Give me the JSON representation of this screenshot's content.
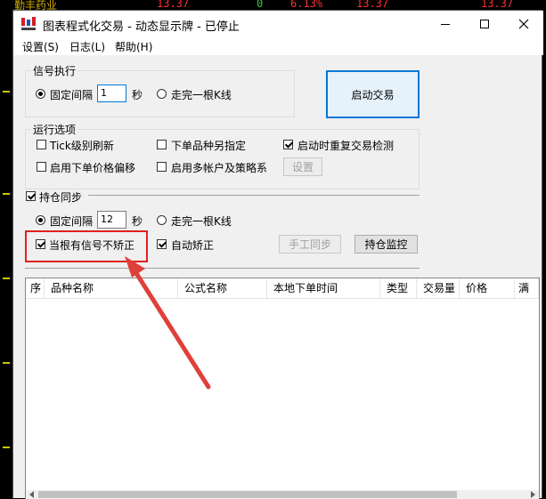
{
  "background": {
    "strip_texts": [
      "勤丰药业",
      "13.37",
      "0",
      "6.13%",
      "13.37",
      "13.37"
    ]
  },
  "window": {
    "title": "图表程式化交易 - 动态显示牌 - 已停止",
    "icon": "app-logo-icon",
    "controls": [
      "minimize-icon",
      "maximize-icon",
      "close-icon"
    ]
  },
  "menu": [
    "设置(S)",
    "日志(L)",
    "帮助(H)"
  ],
  "signal_exec": {
    "group_label": "信号执行",
    "fixed_interval_label": "固定间隔",
    "interval_value": "1",
    "unit": "秒",
    "bar_close_label": "走完一根K线",
    "start_button": "启动交易"
  },
  "run_options": {
    "group_label": "运行选项",
    "tick_refresh": "Tick级别刷新",
    "order_symbol": "下单品种另指定",
    "reload_check": "启动时重复交易检测",
    "price_offset": "启用下单价格偏移",
    "multi_account": "启用多帐户及策略系",
    "settings_button": "设置"
  },
  "position_sync": {
    "label": "持仓同步",
    "fixed_interval_label": "固定间隔",
    "interval_value": "12",
    "unit": "秒",
    "bar_close_label": "走完一根K线",
    "no_correct_label": "当根有信号不矫正",
    "auto_correct_label": "自动矫正",
    "manual_sync_button": "手工同步",
    "monitor_button": "持仓监控"
  },
  "table": {
    "columns": [
      "序",
      "品种名称",
      "公式名称",
      "本地下单时间",
      "类型",
      "交易量",
      "价格",
      "满"
    ]
  },
  "colors": {
    "highlight": "#e02020",
    "arrow": "#e0403b",
    "price_red": "#ff3030",
    "price_green": "#30d030"
  }
}
